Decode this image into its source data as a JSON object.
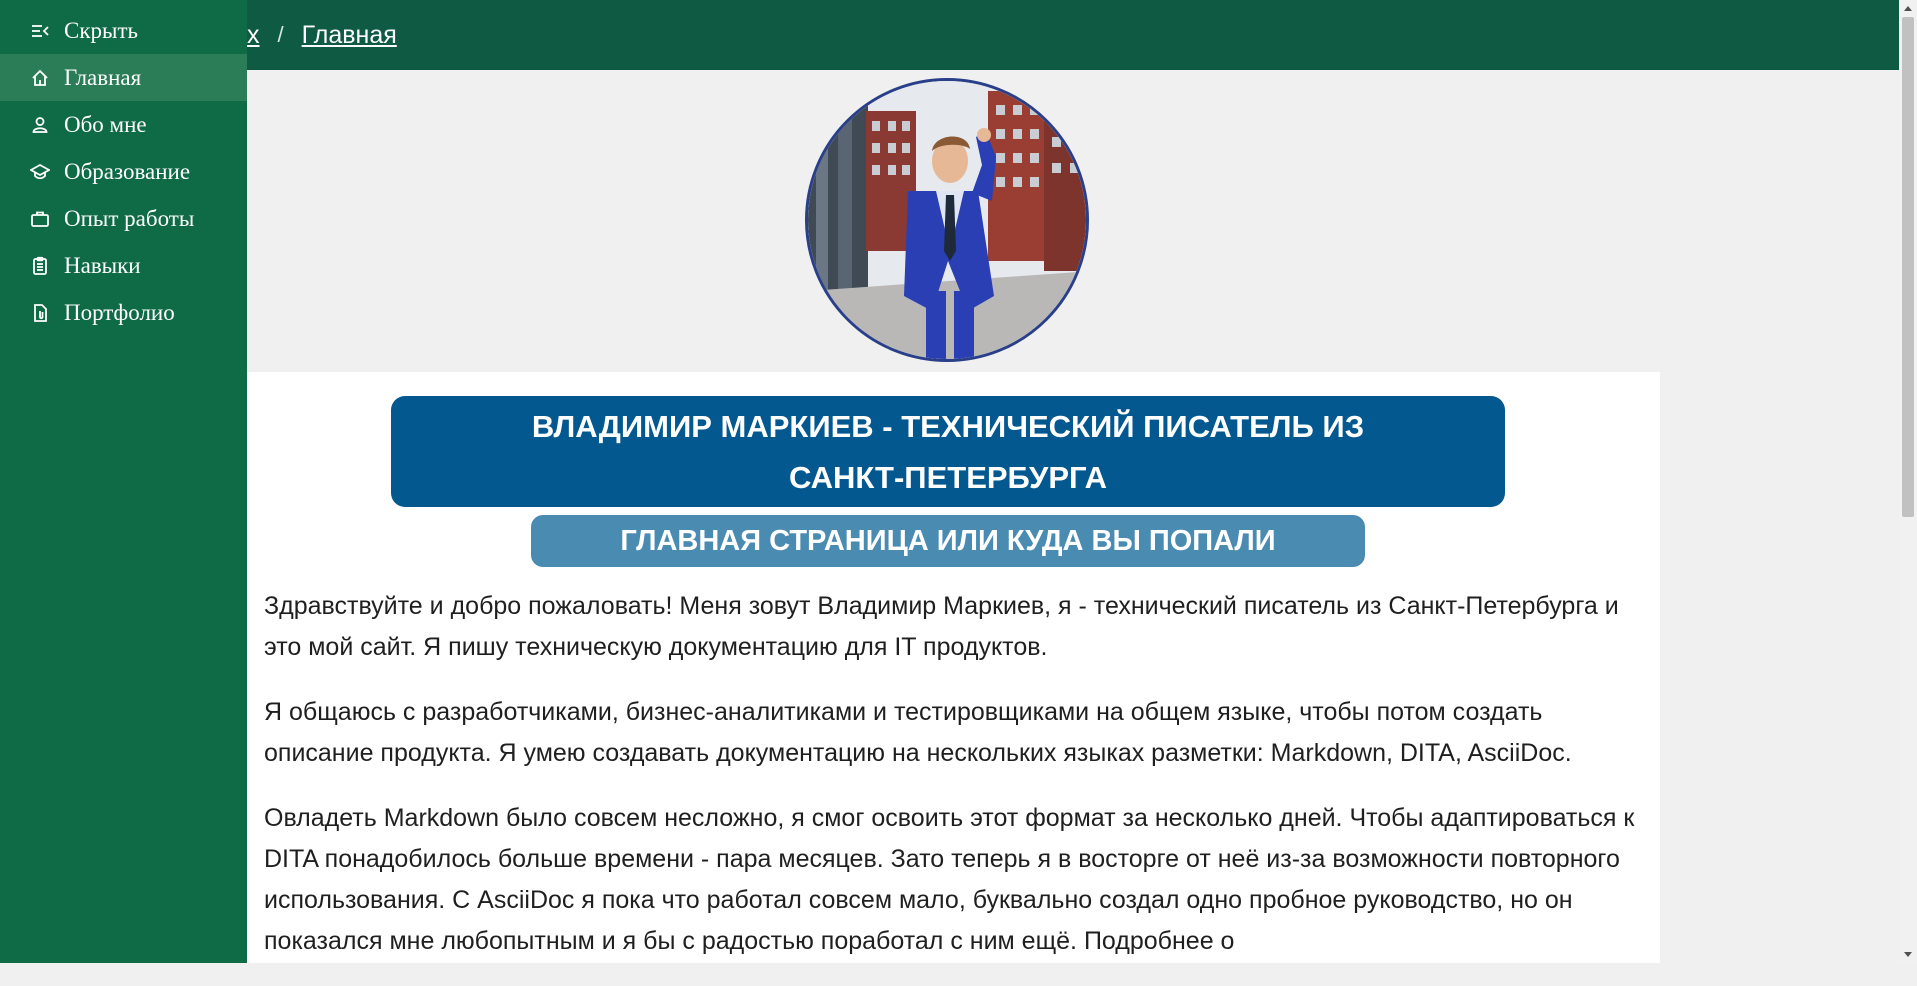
{
  "sidebar": {
    "items": [
      {
        "label": "Скрыть",
        "icon": "collapse-icon"
      },
      {
        "label": "Главная",
        "icon": "home-icon",
        "active": true
      },
      {
        "label": "Обо мне",
        "icon": "user-icon"
      },
      {
        "label": "Образование",
        "icon": "graduation-cap-icon"
      },
      {
        "label": "Опыт работы",
        "icon": "briefcase-icon"
      },
      {
        "label": "Навыки",
        "icon": "clipboard-icon"
      },
      {
        "label": "Портфолио",
        "icon": "file-icon"
      }
    ]
  },
  "header": {
    "breadcrumb": {
      "root": "x",
      "separator": "/",
      "current": "Главная"
    }
  },
  "main": {
    "title": "ВЛАДИМИР МАРКИЕВ - ТЕХНИЧЕСКИЙ ПИСАТЕЛЬ ИЗ САНКТ-ПЕТЕРБУРГА",
    "subtitle": "ГЛАВНАЯ СТРАНИЦА ИЛИ КУДА ВЫ ПОПАЛИ",
    "paragraphs": [
      "Здравствуйте и добро пожаловать! Меня зовут Владимир Маркиев, я - технический писатель из Санкт-Петербурга и это мой сайт. Я пишу техническую документацию для IT продуктов.",
      "Я общаюсь с разработчиками, бизнес-аналитиками и тестировщиками на общем языке, чтобы потом создать описание продукта. Я умею создавать документацию на нескольких языках разметки: Markdown, DITA, AsciiDoc.",
      "Овладеть Markdown было совсем несложно, я смог освоить этот формат за несколько дней. Чтобы адаптироваться к DITA понадобилось больше времени - пара месяцев. Зато теперь я в восторге от неё из-за возможности повторного использования. С AsciiDoc я пока что работал совсем мало, буквально создал одно пробное руководство, но он показался мне любопытным и я бы с радостью поработал с ним ещё. Подробнее о"
    ]
  },
  "colors": {
    "sidebar_bg": "#0e6b45",
    "header_bg": "#0e5a42",
    "title_bg": "#03588f",
    "subtitle_bg": "#4a8bb2"
  }
}
